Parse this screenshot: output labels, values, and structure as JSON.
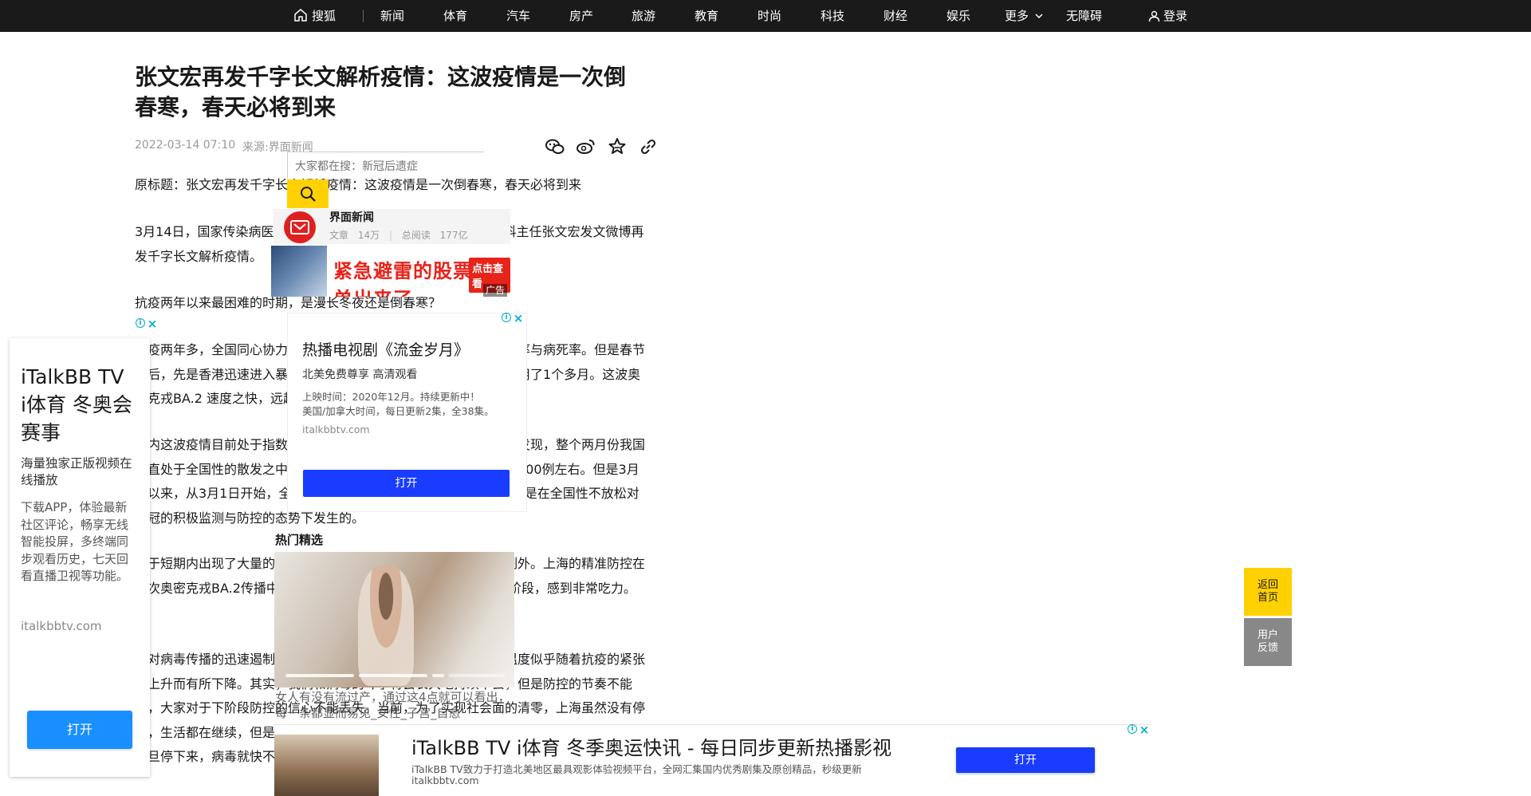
{
  "topbar": {
    "logo_label": "搜狐",
    "nav": [
      "新闻",
      "体育",
      "汽车",
      "房产",
      "旅游",
      "教育",
      "时尚",
      "科技",
      "财经",
      "娱乐",
      "更多",
      "无障碍"
    ],
    "login_label": "登录"
  },
  "article": {
    "title": "张文宏再发千字长文解析疫情：这波疫情是一次倒春寒，春天必将到来",
    "date": "2022-03-14 07:10",
    "source": "来源:界面新闻",
    "paragraphs": [
      "原标题：张文宏再发千字长文解析疫情：这波疫情是一次倒春寒，春天必将到来",
      "3月14日，国家传染病医学中心主任、复旦大学附属华山医院感染科主任张文宏发文微博再发千字长文解析疫情。",
      "抗疫两年以来最困难的时期，是漫长冬夜还是倒春寒？",
      "抗疫两年多，全国同心协力，以最严格的防控措施保持着最低的感染率与病死率。但是春节过后，先是香港迅速进入暴发期，从每日数例上升到数万例，也仅仅用了1个多月。这波奥密克戎BA.2 速度之快，远超预期。",
      "从内这波疫情目前处于指数级上升期，如果不是上海的精准防控及时发现，整个两月份我国一直处于全国性的散发之中，每天本土新增病例数不多，总例数都在200例左右。但是3月初以来，从3月1日开始，全国每日新增病例只用了11天的时间，这还是在全国性不放松对新冠的积极监测与防控的态势下发生的。",
      "由于短期内出现了大量的病例，各地防控的压力都很大，上海也不例外。上海的精准防控在这次奥密克戎BA.2传播中面临巨大挑战，目前仍处于与病毒的赛跑阶段，感到非常吃力。",
      "面对病毒传播的迅速遏制，社会大众对于防控的支持与参与的热情温度似乎随着抗疫的紧张度上升而有所下降。其实，我们和病毒的斗争将会长久地持续下去，但是防控的节奏不能乱，大家对于下阶段防控的信心不能丢失。当前，为了实现社会面的清零，上海虽然没有停工，生活都在继续，但是生活的节奏已经开始防控与筛查。我们相信，这次病毒的上升态势一旦停下来，病毒就快不了。"
    ]
  },
  "search": {
    "placeholder": "大家都在搜：新冠后遗症"
  },
  "source_card": {
    "name": "界面新闻",
    "articles_label": "文章",
    "articles_value": "14万",
    "reads_label": "总阅读",
    "reads_value": "177亿"
  },
  "ad_banner": {
    "text": "紧急避雷的股票名单出来了",
    "cta": "点击查看",
    "tag": "广告"
  },
  "ad_mid": {
    "title": "热播电视剧《流金岁月》",
    "subtitle": "北美免费尊享 高清观看",
    "line1": "上映时间：2020年12月。持续更新中！",
    "line2": "美国/加拿大时间，每日更新2集，全38集。",
    "domain": "italkbbtv.com",
    "button": "打开"
  },
  "left_ad": {
    "title": "iTalkBB TV i体育 冬奥会赛事",
    "subtitle": "海量独家正版视频在线播放",
    "description": "下载APP，体验最新社区评论，畅享无线智能投屏，多终端同步观看历史，七天回看直播卫视等功能。",
    "domain": "italkbbtv.com",
    "button": "打开"
  },
  "hot": {
    "title": "热门精选",
    "caption": "女人有没有流过产，通过这4点就可以看出，每一条都显而易见_女性_子宫_自愈"
  },
  "bottom_ad": {
    "title": "iTalkBB TV i体育 冬季奥运快讯 - 每日同步更新热播影视",
    "description": "iTalkBB TV致力于打造北美地区最具观影体验视频平台，全网汇集国内优秀剧集及原创精品，秒级更新",
    "domain": "italkbbtv.com",
    "button": "打开"
  },
  "side": {
    "back_home": "返回首页",
    "feedback": "用户反馈"
  },
  "colors": {
    "topbar": "#1a1a1a",
    "accent_yellow": "#ffd100",
    "ad_button_blue": "#1a3cff",
    "left_ad_button": "#1a8fff",
    "ad_icon": "#00aecd"
  }
}
